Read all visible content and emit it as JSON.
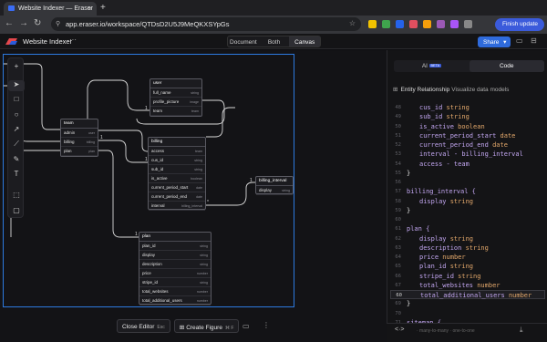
{
  "browser": {
    "tab_title": "Website Indexer — Eraser",
    "tab_close": "×",
    "new_tab": "+",
    "url": "app.eraser.io/workspace/QTDsD2U5J9MeQKXSYpGs",
    "finish_update": "Finish update",
    "nav_back": "←",
    "nav_forward": "→",
    "nav_reload": "↻",
    "extension_colors": [
      "#f2c200",
      "#3fa34d",
      "#2563eb",
      "#e04f5f",
      "#f59e0b",
      "#9b59b6",
      "#a855f7",
      "#888888"
    ]
  },
  "app": {
    "project_name": "Website Indexer",
    "project_menu": "···",
    "view_modes": [
      "Document",
      "Both",
      "Canvas"
    ],
    "active_view": "Canvas",
    "share_label": "Share",
    "share_caret": "▾",
    "brand_color": "#e5484d"
  },
  "toolbar": {
    "tools": [
      {
        "name": "add-tool",
        "glyph": "+"
      },
      {
        "name": "select-tool",
        "glyph": "➤"
      },
      {
        "name": "rectangle-tool",
        "glyph": "□"
      },
      {
        "name": "ellipse-tool",
        "glyph": "○"
      },
      {
        "name": "arrow-tool",
        "glyph": "↗"
      },
      {
        "name": "line-tool",
        "glyph": "⟋"
      },
      {
        "name": "pen-tool",
        "glyph": "✎"
      },
      {
        "name": "text-tool",
        "glyph": "T"
      },
      {
        "name": "frame-tool",
        "glyph": "⬚"
      },
      {
        "name": "comment-tool",
        "glyph": "▢"
      }
    ]
  },
  "diagram": {
    "entities": [
      {
        "id": "user",
        "title": "user",
        "rows": [
          [
            "full_name",
            "string"
          ],
          [
            "profile_picture",
            "image"
          ],
          [
            "team",
            "team"
          ]
        ]
      },
      {
        "id": "team",
        "title": "team",
        "rows": [
          [
            "admin",
            "user"
          ],
          [
            "billing",
            "billing"
          ],
          [
            "plan",
            "plan"
          ]
        ]
      },
      {
        "id": "billing",
        "title": "billing",
        "rows": [
          [
            "access",
            "team"
          ],
          [
            "cus_id",
            "string"
          ],
          [
            "sub_id",
            "string"
          ],
          [
            "is_active",
            "boolean"
          ],
          [
            "current_period_start",
            "date"
          ],
          [
            "current_period_end",
            "date"
          ],
          [
            "interval",
            "billing_interval"
          ]
        ]
      },
      {
        "id": "billing_interval",
        "title": "billing_interval",
        "rows": [
          [
            "display",
            "string"
          ]
        ]
      },
      {
        "id": "plan",
        "title": "plan",
        "rows": [
          [
            "plan_id",
            "string"
          ],
          [
            "display",
            "string"
          ],
          [
            "description",
            "string"
          ],
          [
            "price",
            "number"
          ],
          [
            "stripe_id",
            "string"
          ],
          [
            "total_websites",
            "number"
          ],
          [
            "total_additional_users",
            "number"
          ]
        ]
      }
    ]
  },
  "bottom_bar": {
    "close_editor": "Close Editor",
    "close_editor_key": "Esc",
    "create_figure": "Create Figure",
    "create_figure_key": "⌘ F"
  },
  "panel": {
    "tabs": [
      "AI",
      "Code"
    ],
    "beta": "BETA",
    "active_tab": "Code",
    "diagram_type": "Entity Relationship",
    "diagram_type_sub": "Visualize data models",
    "code_lines": [
      {
        "n": "48",
        "text": "cus_id string",
        "kind": "field"
      },
      {
        "n": "49",
        "text": "sub_id string",
        "kind": "field"
      },
      {
        "n": "50",
        "text": "is_active boolean",
        "kind": "field"
      },
      {
        "n": "51",
        "text": "current_period_start date",
        "kind": "field"
      },
      {
        "n": "52",
        "text": "current_period_end date",
        "kind": "field"
      },
      {
        "n": "53",
        "text": "interval - billing_interval",
        "kind": "rel"
      },
      {
        "n": "54",
        "text": "access - team",
        "kind": "rel"
      },
      {
        "n": "55",
        "text": "}",
        "kind": "brace0"
      },
      {
        "n": "56",
        "text": "",
        "kind": "blank"
      },
      {
        "n": "57",
        "text": "billing_interval {",
        "kind": "open"
      },
      {
        "n": "58",
        "text": "display string",
        "kind": "field"
      },
      {
        "n": "59",
        "text": "}",
        "kind": "brace0"
      },
      {
        "n": "60",
        "text": "",
        "kind": "blank"
      },
      {
        "n": "61",
        "text": "plan {",
        "kind": "open"
      },
      {
        "n": "62",
        "text": "display string",
        "kind": "field"
      },
      {
        "n": "63",
        "text": "description string",
        "kind": "field"
      },
      {
        "n": "64",
        "text": "price number",
        "kind": "field"
      },
      {
        "n": "65",
        "text": "plan_id string",
        "kind": "field"
      },
      {
        "n": "66",
        "text": "stripe_id string",
        "kind": "field"
      },
      {
        "n": "67",
        "text": "total_websites number",
        "kind": "field"
      },
      {
        "n": "60",
        "text": "total_additional_users number",
        "kind": "current"
      },
      {
        "n": "69",
        "text": "}",
        "kind": "brace0"
      },
      {
        "n": "70",
        "text": "",
        "kind": "blank"
      },
      {
        "n": "71",
        "text": "sitemap {",
        "kind": "open"
      }
    ],
    "footer_icon": "<·>",
    "footer_text": "· many-to-many · one-to-one",
    "download_icon": "⤓"
  }
}
